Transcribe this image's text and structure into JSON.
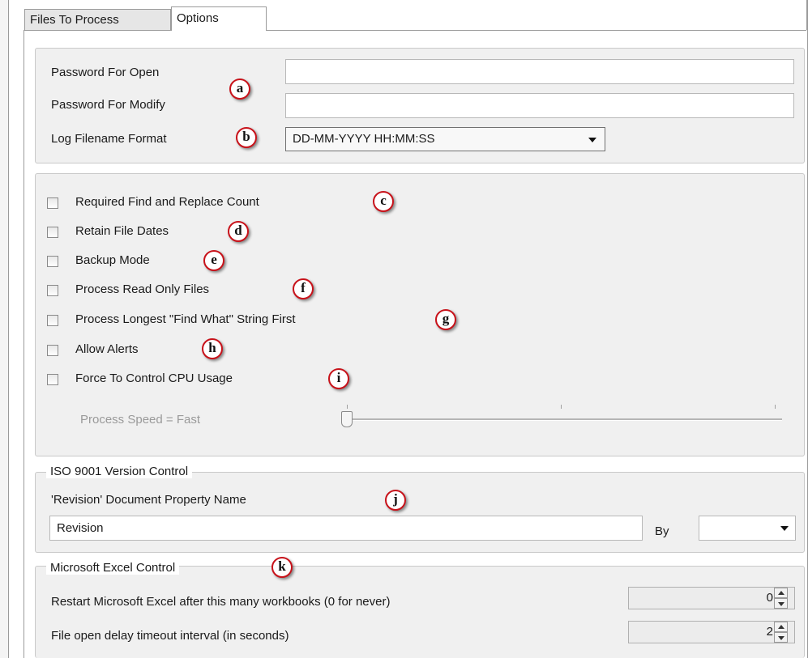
{
  "tabs": [
    {
      "label": "Files To Process",
      "active": false
    },
    {
      "label": "Options",
      "active": true
    }
  ],
  "passwords": {
    "open_label": "Password For Open",
    "open_value": "",
    "modify_label": "Password For Modify",
    "modify_value": "",
    "log_label": "Log Filename Format",
    "log_value": "DD-MM-YYYY HH:MM:SS"
  },
  "options": [
    {
      "label": "Required Find and Replace Count",
      "checked": false,
      "badge": "c"
    },
    {
      "label": "Retain File Dates",
      "checked": false,
      "badge": "d"
    },
    {
      "label": "Backup Mode",
      "checked": false,
      "badge": "e"
    },
    {
      "label": "Process Read Only Files",
      "checked": false,
      "badge": "f"
    },
    {
      "label": "Process Longest \"Find What\" String First",
      "checked": false,
      "badge": "g"
    },
    {
      "label": "Allow Alerts",
      "checked": false,
      "badge": "h"
    },
    {
      "label": "Force To Control CPU Usage",
      "checked": false,
      "badge": "i"
    }
  ],
  "speed": {
    "label": "Process Speed = Fast",
    "level": 0
  },
  "iso": {
    "legend": "ISO 9001 Version Control",
    "property_label": "'Revision' Document Property Name",
    "property_value": "Revision",
    "by_label": "By",
    "by_value": ""
  },
  "excel": {
    "legend": "Microsoft Excel Control",
    "restart_label": "Restart Microsoft Excel after this many workbooks (0 for never)",
    "restart_value": "0",
    "delay_label": "File open delay timeout interval (in seconds)",
    "delay_value": "2"
  },
  "badges": {
    "a": "a",
    "b": "b",
    "j": "j",
    "k": "k"
  },
  "colors": {
    "badge_ring": "#c8121a",
    "panel_bg": "#f0f0f0",
    "tab_border": "#9a9a9a"
  }
}
